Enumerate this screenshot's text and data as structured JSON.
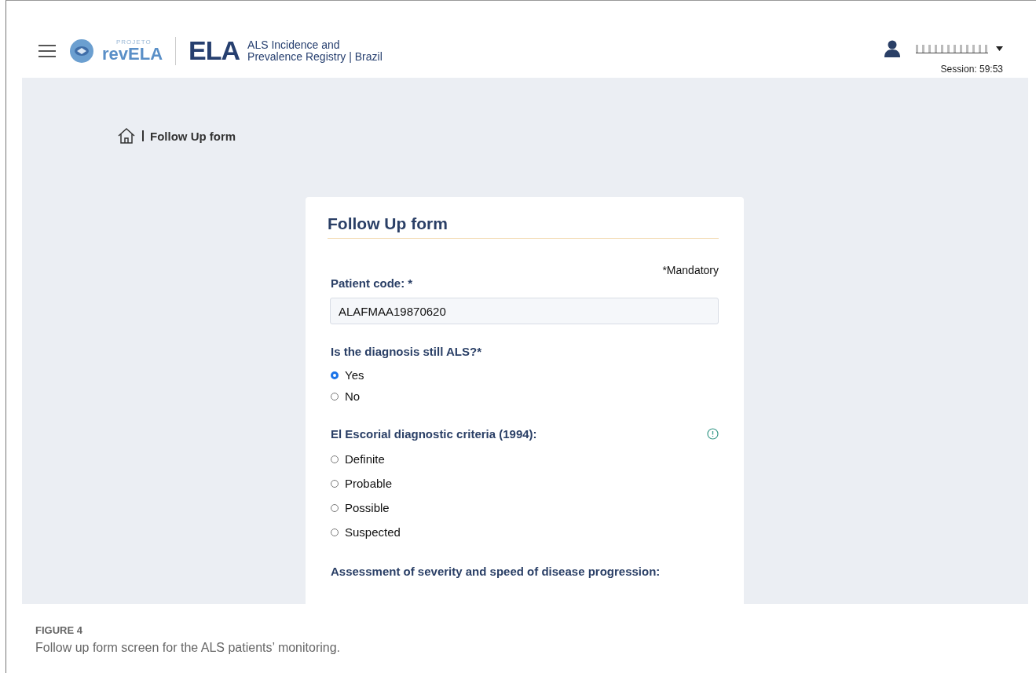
{
  "header": {
    "logo_small": "PROJETO",
    "logo": "revELA",
    "brand": "ELA",
    "subtitle_lines": [
      "ALS Incidence and",
      "Prevalence Registry | Brazil"
    ],
    "session": "Session: 59:53"
  },
  "breadcrumb": {
    "current": "Follow Up form"
  },
  "form": {
    "title": "Follow Up form",
    "mandatory_note": "*Mandatory",
    "patient_code": {
      "label": "Patient code: *",
      "value": "ALAFMAA19870620"
    },
    "questions": [
      {
        "label": "Is the diagnosis still ALS?*",
        "info": false,
        "options": [
          {
            "label": "Yes",
            "selected": true
          },
          {
            "label": "No",
            "selected": false
          }
        ]
      },
      {
        "label": "El Escorial diagnostic criteria (1994):",
        "info": true,
        "options": [
          {
            "label": "Definite",
            "selected": false
          },
          {
            "label": "Probable",
            "selected": false
          },
          {
            "label": "Possible",
            "selected": false
          },
          {
            "label": "Suspected",
            "selected": false
          }
        ]
      },
      {
        "label": "Assessment of severity and speed of disease progression:",
        "info": false
      }
    ]
  },
  "caption": {
    "label": "FIGURE 4",
    "text": "Follow up form screen for the ALS patients’ monitoring."
  }
}
